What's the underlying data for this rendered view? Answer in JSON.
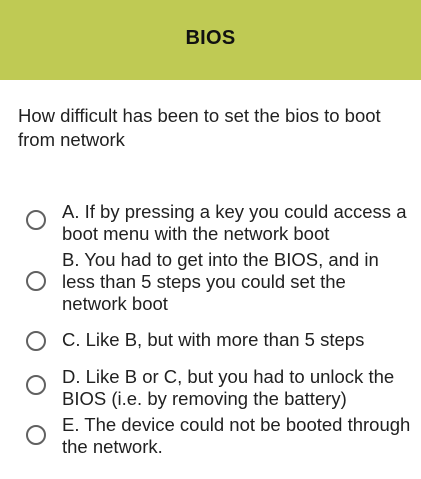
{
  "header": {
    "title": "BIOS"
  },
  "question": {
    "text": "How difficult has been to set the bios to boot from network"
  },
  "options": [
    {
      "label": "A. If by pressing a key you could access a boot menu with the network boot",
      "selected": false
    },
    {
      "label": "B. You had to get into the BIOS, and in less than 5 steps you could set the network boot",
      "selected": false
    },
    {
      "label": "C. Like B, but with more than 5 steps",
      "selected": false
    },
    {
      "label": "D. Like B or C, but you had to unlock the BIOS (i.e. by removing the battery)",
      "selected": false
    },
    {
      "label": "E. The device could not be booted through the network.",
      "selected": false
    }
  ],
  "colors": {
    "header_bg": "#bfca54",
    "text": "#212121",
    "radio_border": "#616161"
  }
}
